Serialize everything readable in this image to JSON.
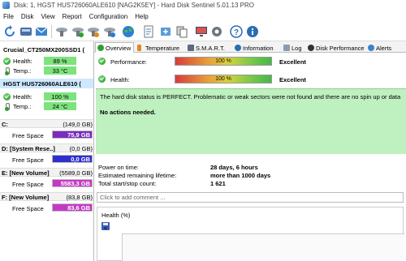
{
  "window": {
    "title": "Disk: 1, HGST HUS726060ALE610 [NAG2K5EY]  -  Hard Disk Sentinel 5.01.13 PRO"
  },
  "menu": [
    "File",
    "Disk",
    "View",
    "Report",
    "Configuration",
    "Help"
  ],
  "toolbar": {
    "icons": [
      "refresh-icon",
      "disk-icon",
      "email-icon",
      "test-icon",
      "surface-test-icon",
      "repair-test-icon",
      "config-test-icon",
      "globe-icon",
      "report-icon",
      "backup-icon",
      "copy-icon",
      "monitor-icon",
      "settings-icon",
      "help-icon",
      "info-icon"
    ]
  },
  "disks": [
    {
      "name": "Crucial_CT250MX200SSD1 (",
      "health_label": "Health:",
      "health_value": "89 %",
      "health_fraction": 0.89,
      "temp_label": "Temp.:",
      "temp_value": "33 °C",
      "selected": false
    },
    {
      "name": "HGST HUS726060ALE610 (",
      "health_label": "Health:",
      "health_value": "100 %",
      "health_fraction": 1.0,
      "temp_label": "Temp.:",
      "temp_value": "24 °C",
      "selected": true
    }
  ],
  "volumes": [
    {
      "name": "C:",
      "size": "(149,0 GB)",
      "free_label": "Free Space",
      "free_value": "75,9 GB",
      "color": "#7a2bbf"
    },
    {
      "name": "D: [System Rese..]",
      "size": "(0,0 GB)",
      "free_label": "Free Space",
      "free_value": "0,0 GB",
      "color": "#2f2fd0"
    },
    {
      "name": "E: [New Volume]",
      "size": "(5589,0 GB)",
      "free_label": "Free Space",
      "free_value": "5583,3 GB",
      "color": "#c43ac4"
    },
    {
      "name": "F: [New Volume]",
      "size": "(83,8 GB)",
      "free_label": "Free Space",
      "free_value": "83,6 GB",
      "color": "#c43ac4"
    }
  ],
  "tabs": [
    {
      "label": "Overview",
      "active": true
    },
    {
      "label": "Temperature",
      "active": false
    },
    {
      "label": "S.M.A.R.T.",
      "active": false
    },
    {
      "label": "Information",
      "active": false
    },
    {
      "label": "Log",
      "active": false
    },
    {
      "label": "Disk Performance",
      "active": false
    },
    {
      "label": "Alerts",
      "active": false
    }
  ],
  "overview": {
    "performance": {
      "label": "Performance:",
      "value": "100 %",
      "fraction": 1.0,
      "rating": "Excellent"
    },
    "health": {
      "label": "Health:",
      "value": "100 %",
      "fraction": 1.0,
      "rating": "Excellent"
    },
    "status_text": "The hard disk status is PERFECT. Problematic or weak sectors were not found and there are no spin up or data",
    "action_text": "No actions needed.",
    "info": [
      {
        "label": "Power on time:",
        "value": "28 days, 6 hours"
      },
      {
        "label": "Estimated remaining lifetime:",
        "value": "more than 1000 days"
      },
      {
        "label": "Total start/stop count:",
        "value": "1 621"
      }
    ],
    "comment_placeholder": "Click to add comment ...",
    "health_chart_title": "Health (%)"
  },
  "colors": {
    "status_green": "#bff0bf",
    "selected_disk": "#cde8ff",
    "value_green": "#7ee37e"
  }
}
